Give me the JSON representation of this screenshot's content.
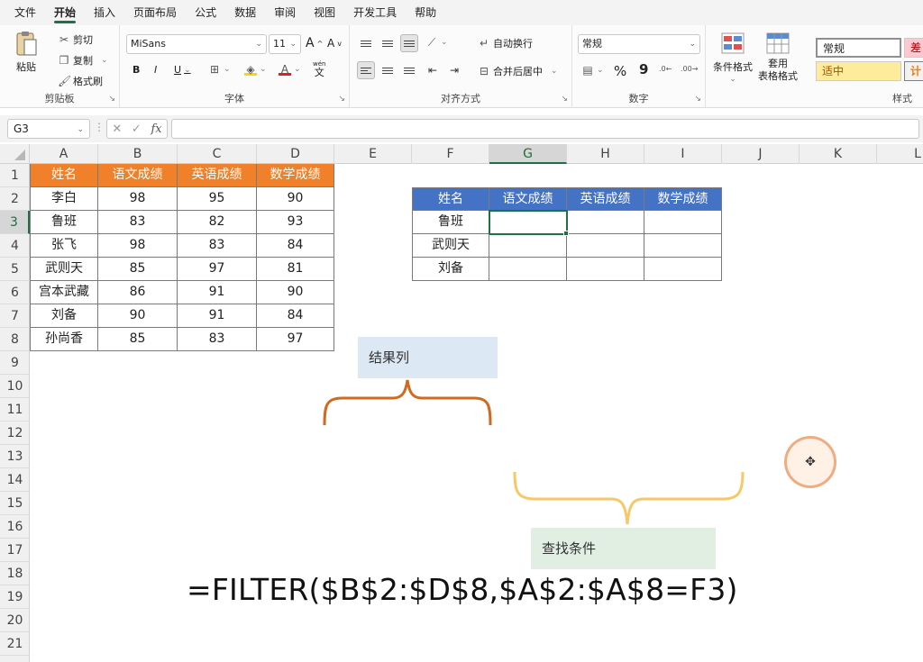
{
  "menu": {
    "items": [
      "文件",
      "开始",
      "插入",
      "页面布局",
      "公式",
      "数据",
      "审阅",
      "视图",
      "开发工具",
      "帮助"
    ],
    "active_index": 1
  },
  "ribbon": {
    "clipboard": {
      "paste": "粘贴",
      "cut": "剪切",
      "copy": "复制",
      "format_painter": "格式刷",
      "label": "剪贴板"
    },
    "font": {
      "name": "MiSans",
      "size": "11",
      "bold": "B",
      "italic": "I",
      "underline": "U",
      "grow": "A",
      "shrink": "A",
      "font_color": "A",
      "label": "字体",
      "wen": "wén",
      "wen_char": "文"
    },
    "alignment": {
      "wrap": "自动换行",
      "merge": "合并后居中",
      "label": "对齐方式"
    },
    "number": {
      "format": "常规",
      "percent": "%",
      "comma": "9",
      "label": "数字"
    },
    "styles": {
      "conditional": "条件格式",
      "table_format_1": "套用",
      "table_format_2": "表格格式",
      "normal": "常规",
      "bad": "差",
      "neutral": "适中",
      "calc": "计",
      "label": "样式"
    }
  },
  "formula_bar": {
    "name_box": "G3",
    "fx": "fx",
    "value": ""
  },
  "columns": [
    "A",
    "B",
    "C",
    "D",
    "E",
    "F",
    "G",
    "H",
    "I",
    "J",
    "K",
    "L"
  ],
  "rows": [
    "1",
    "2",
    "3",
    "4",
    "5",
    "6",
    "7",
    "8",
    "9",
    "10",
    "11",
    "12",
    "13",
    "14",
    "15",
    "16",
    "17",
    "18",
    "19",
    "20",
    "21"
  ],
  "selected_cell": "G3",
  "source_table": {
    "headers": [
      "姓名",
      "语文成绩",
      "英语成绩",
      "数学成绩"
    ],
    "rows": [
      [
        "李白",
        "98",
        "95",
        "90"
      ],
      [
        "鲁班",
        "83",
        "82",
        "93"
      ],
      [
        "张飞",
        "98",
        "83",
        "84"
      ],
      [
        "武则天",
        "85",
        "97",
        "81"
      ],
      [
        "宫本武藏",
        "86",
        "91",
        "90"
      ],
      [
        "刘备",
        "90",
        "91",
        "84"
      ],
      [
        "孙尚香",
        "85",
        "83",
        "97"
      ]
    ]
  },
  "lookup_table": {
    "headers": [
      "姓名",
      "语文成绩",
      "英语成绩",
      "数学成绩"
    ],
    "rows": [
      [
        "鲁班",
        "",
        "",
        ""
      ],
      [
        "武则天",
        "",
        "",
        ""
      ],
      [
        "刘备",
        "",
        "",
        ""
      ]
    ]
  },
  "annotation": {
    "formula": "=FILTER($B$2:$D$8,$A$2:$A$8=F3)",
    "result_label": "结果列",
    "condition_label": "查找条件",
    "colors": {
      "result_brace": "#d2691e",
      "condition_brace": "#f5c96a",
      "result_box": "#dce9f5",
      "condition_box": "#e1efe3"
    }
  }
}
